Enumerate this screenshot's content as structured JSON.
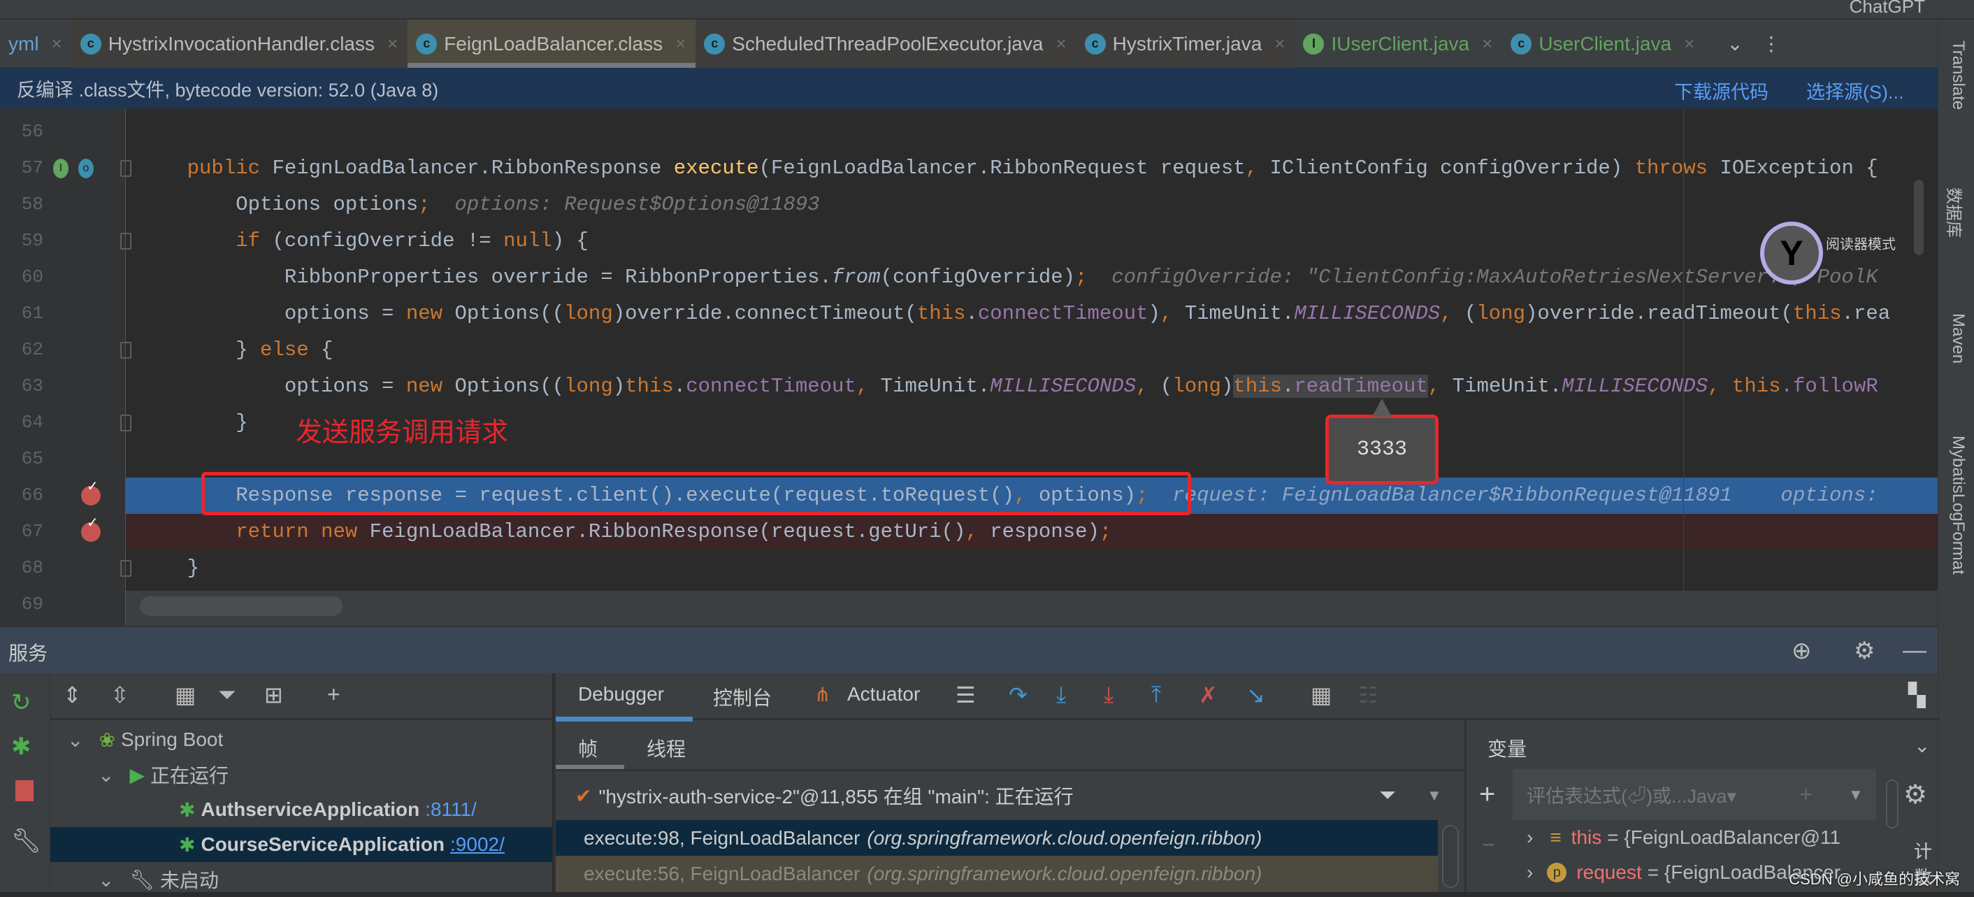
{
  "topbar": {
    "chatgpt": "ChatGPT"
  },
  "tabs": [
    {
      "label": "yml",
      "icon": "yaml-icon",
      "kind": "project",
      "color": "#6a9fd4"
    },
    {
      "label": "HystrixInvocationHandler.class",
      "icon": "class-icon",
      "kind": "lib",
      "color": "#bbbbbb"
    },
    {
      "label": "FeignLoadBalancer.class",
      "icon": "class-icon",
      "kind": "active",
      "color": "#bbbbbb"
    },
    {
      "label": "ScheduledThreadPoolExecutor.java",
      "icon": "class-icon",
      "kind": "lib",
      "color": "#bbbbbb"
    },
    {
      "label": "HystrixTimer.java",
      "icon": "class-icon",
      "kind": "lib",
      "color": "#bbbbbb"
    },
    {
      "label": "IUserClient.java",
      "icon": "interface-icon",
      "kind": "project",
      "color": "#62a55d"
    },
    {
      "label": "UserClient.java",
      "icon": "class-icon",
      "kind": "project",
      "color": "#62a55d"
    }
  ],
  "notification": {
    "text": "反编译 .class文件, bytecode version: 52.0 (Java 8)",
    "download_source": "下载源代码",
    "choose_source": "选择源(S)..."
  },
  "editor": {
    "reader_mode": "阅读器模式",
    "annotation": "发送服务调用请求",
    "tooltip_value": "3333",
    "highlight_color": "#2d5f99",
    "breakpoint_line_color": "#3b2526",
    "lines": [
      {
        "n": "56",
        "tokens": []
      },
      {
        "n": "57",
        "tokens": [
          [
            "    ",
            "d"
          ],
          [
            "public",
            "k"
          ],
          [
            " FeignLoadBalancer.RibbonResponse ",
            "d"
          ],
          [
            "execute",
            "m"
          ],
          [
            "(FeignLoadBalancer.RibbonRequest request",
            "d"
          ],
          [
            ",",
            "k"
          ],
          [
            " IClientConfig configOverride) ",
            "d"
          ],
          [
            "throws",
            "k"
          ],
          [
            " IOException {",
            "d"
          ]
        ]
      },
      {
        "n": "58",
        "tokens": [
          [
            "        Options options",
            "d"
          ],
          [
            ";",
            "k"
          ],
          [
            "  options: Request$Options@11893",
            "h"
          ]
        ]
      },
      {
        "n": "59",
        "tokens": [
          [
            "        ",
            "d"
          ],
          [
            "if",
            "k"
          ],
          [
            " (configOverride != ",
            "d"
          ],
          [
            "null",
            "k"
          ],
          [
            ") {",
            "d"
          ]
        ]
      },
      {
        "n": "60",
        "tokens": [
          [
            "            RibbonProperties override = RibbonProperties.",
            "d"
          ],
          [
            "from",
            "it"
          ],
          [
            "(configOverride)",
            "d"
          ],
          [
            ";",
            "k"
          ],
          [
            "  configOverride: \"ClientConfig:MaxAutoRetriesNextServer:1, PoolK",
            "h"
          ]
        ]
      },
      {
        "n": "61",
        "tokens": [
          [
            "            options = ",
            "d"
          ],
          [
            "new",
            "k"
          ],
          [
            " Options((",
            "d"
          ],
          [
            "long",
            "k"
          ],
          [
            ")override.connectTimeout(",
            "d"
          ],
          [
            "this",
            "k"
          ],
          [
            ".",
            "d"
          ],
          [
            "connectTimeout",
            "f"
          ],
          [
            ")",
            "d"
          ],
          [
            ",",
            "k"
          ],
          [
            " TimeUnit.",
            "d"
          ],
          [
            "MILLISECONDS",
            "fi"
          ],
          [
            ",",
            "k"
          ],
          [
            " (",
            "d"
          ],
          [
            "long",
            "k"
          ],
          [
            ")override.readTimeout(",
            "d"
          ],
          [
            "this",
            "k"
          ],
          [
            ".rea",
            "d"
          ]
        ]
      },
      {
        "n": "62",
        "tokens": [
          [
            "        } ",
            "d"
          ],
          [
            "else",
            "k"
          ],
          [
            " {",
            "d"
          ]
        ]
      },
      {
        "n": "63",
        "tokens": [
          [
            "            options = ",
            "d"
          ],
          [
            "new",
            "k"
          ],
          [
            " Options((",
            "d"
          ],
          [
            "long",
            "k"
          ],
          [
            ")",
            "d"
          ],
          [
            "this",
            "k"
          ],
          [
            ".",
            "d"
          ],
          [
            "connectTimeout",
            "f"
          ],
          [
            ",",
            "k"
          ],
          [
            " TimeUnit.",
            "d"
          ],
          [
            "MILLISECONDS",
            "fi"
          ],
          [
            ",",
            "k"
          ],
          [
            " (",
            "d"
          ],
          [
            "long",
            "k"
          ],
          [
            ")",
            "d"
          ],
          [
            "this",
            "k hl"
          ],
          [
            ".",
            "d hl"
          ],
          [
            "readTimeout",
            "f hl"
          ],
          [
            ",",
            "k"
          ],
          [
            " TimeUnit.",
            "d"
          ],
          [
            "MILLISECONDS",
            "fi"
          ],
          [
            ",",
            "k"
          ],
          [
            " ",
            "d"
          ],
          [
            "this",
            "k"
          ],
          [
            ".followR",
            "f"
          ]
        ]
      },
      {
        "n": "64",
        "tokens": [
          [
            "        }",
            "d"
          ]
        ]
      },
      {
        "n": "65",
        "tokens": []
      },
      {
        "n": "66",
        "tokens": [
          [
            "        Response response = request.client().execute(request.toRequest()",
            "d"
          ],
          [
            ",",
            "k"
          ],
          [
            " options)",
            "d"
          ],
          [
            ";",
            "k"
          ],
          [
            "  request: FeignLoadBalancer$RibbonRequest@11891    options:",
            "hb"
          ]
        ],
        "state": "current",
        "breakpoint": true
      },
      {
        "n": "67",
        "tokens": [
          [
            "        ",
            "d"
          ],
          [
            "return",
            "k"
          ],
          [
            " ",
            "d"
          ],
          [
            "new",
            "k"
          ],
          [
            " FeignLoadBalancer.RibbonResponse(request.getUri()",
            "d"
          ],
          [
            ",",
            "k"
          ],
          [
            " response)",
            "d"
          ],
          [
            ";",
            "k"
          ]
        ],
        "state": "breakpoint",
        "breakpoint": true
      },
      {
        "n": "68",
        "tokens": [
          [
            "    }",
            "d"
          ]
        ]
      },
      {
        "n": "69",
        "tokens": []
      }
    ]
  },
  "right_strip": [
    "Translate",
    "数据库",
    "Maven",
    "MybatisLogFormat"
  ],
  "services": {
    "title": "服务",
    "tree": [
      {
        "label": "Spring Boot",
        "depth": 0,
        "icon": "spring-boot-icon"
      },
      {
        "label": "正在运行",
        "depth": 1,
        "icon": "run-icon"
      },
      {
        "label": "AuthserviceApplication",
        "port": ":8111/",
        "depth": 2,
        "icon": "debug-bug-icon"
      },
      {
        "label": "CourseServiceApplication",
        "port": ":9002/",
        "depth": 2,
        "icon": "debug-bug-icon",
        "selected": true
      },
      {
        "label": "未启动",
        "depth": 1,
        "icon": "wrench-icon"
      }
    ]
  },
  "debugger": {
    "tabs": [
      "Debugger",
      "控制台",
      "Actuator"
    ],
    "subtabs": [
      "帧",
      "线程"
    ],
    "thread": "\"hystrix-auth-service-2\"@11,855 在组 \"main\": 正在运行",
    "frames": [
      {
        "method": "execute:98, FeignLoadBalancer",
        "pkg": "(org.springframework.cloud.openfeign.ribbon)",
        "selected": true
      },
      {
        "method": "execute:56, FeignLoadBalancer",
        "pkg": "(org.springframework.cloud.openfeign.ribbon)"
      }
    ],
    "variables_title": "变量",
    "eval_placeholder": "评估表达式(⏎)或...Java▾",
    "variables": [
      {
        "name": "this",
        "value": "= {FeignLoadBalancer@11",
        "icon": "field-icon"
      },
      {
        "name": "request",
        "value": "= {FeignLoadBalancer",
        "icon": "parameter-icon"
      }
    ],
    "count_label": "计数"
  },
  "watermark": "CSDN @小咸鱼的技术窝"
}
